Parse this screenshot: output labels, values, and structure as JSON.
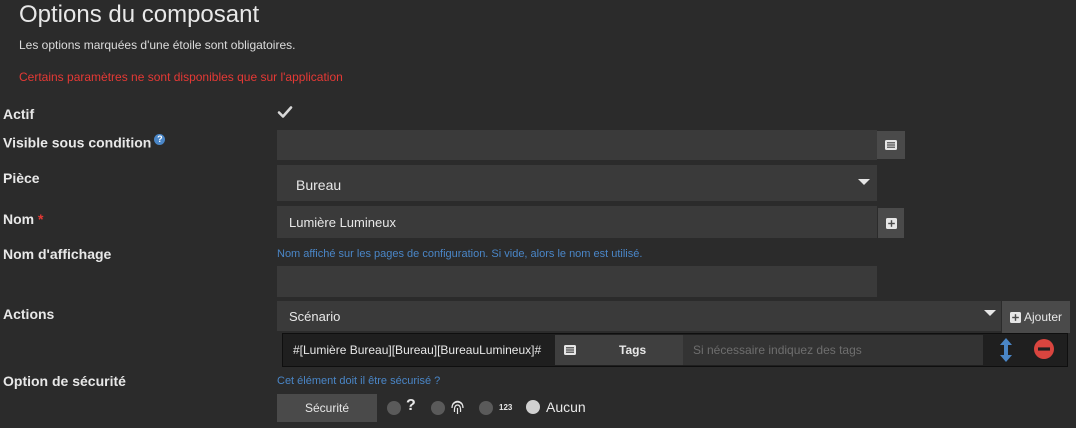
{
  "header": {
    "title": "Options du composant",
    "subtitle": "Les options marquées d'une étoile sont obligatoires.",
    "warning": "Certains paramètres ne sont disponibles que sur l'application",
    "warning_color": "#e53935"
  },
  "colors": {
    "accent": "#4a86c7",
    "background": "#2b2b2b",
    "danger": "#d9453f"
  },
  "fields": {
    "actif": {
      "label": "Actif",
      "checked": true
    },
    "visible": {
      "label": "Visible sous condition",
      "help_icon": "?",
      "value": ""
    },
    "piece": {
      "label": "Pièce",
      "value": "Bureau"
    },
    "nom": {
      "label": "Nom",
      "required_mark": "*",
      "value": "Lumière Lumineux"
    },
    "nom_affichage": {
      "label": "Nom d'affichage",
      "hint": "Nom affiché sur les pages de configuration. Si vide, alors le nom est utilisé.",
      "value": ""
    },
    "actions": {
      "label": "Actions",
      "select_value": "Scénario",
      "add_label": "Ajouter",
      "rows": [
        {
          "command": "#[Lumière Bureau][Bureau][BureauLumineux]#",
          "tags_label": "Tags",
          "tags_placeholder": "Si nécessaire indiquez des tags"
        }
      ]
    },
    "securite": {
      "label": "Option de sécurité",
      "hint": "Cet élément doit il être sécurisé ?",
      "button_label": "Sécurité",
      "options": [
        {
          "icon": "question-icon",
          "text": "?"
        },
        {
          "icon": "fingerprint-icon",
          "text": ""
        },
        {
          "icon": "pin-code-icon",
          "text": "123"
        },
        {
          "icon": "none",
          "text": "Aucun"
        }
      ],
      "selected_option": "Aucun"
    }
  }
}
